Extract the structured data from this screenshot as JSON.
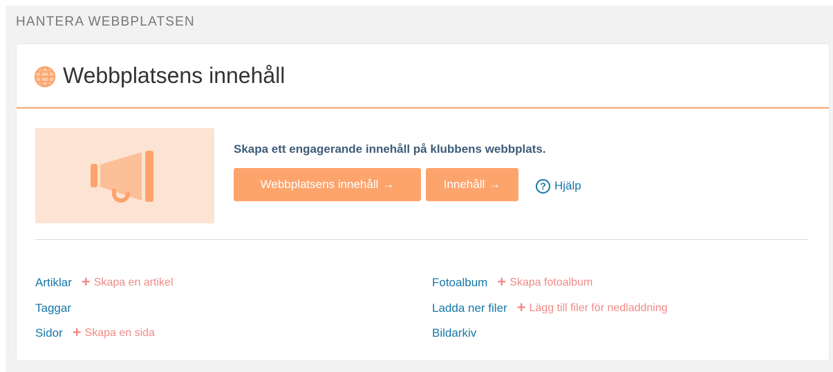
{
  "section_title": "HANTERA WEBBPLATSEN",
  "card": {
    "title": "Webbplatsens innehåll",
    "icon": "globe-icon"
  },
  "promo": {
    "image_icon": "megaphone-icon",
    "text": "Skapa ett engagerande innehåll på klubbens webbplats.",
    "buttons": [
      {
        "label": "Webbplatsens innehåll",
        "arrow": "→"
      },
      {
        "label": "Innehåll",
        "arrow": "→"
      }
    ],
    "help": {
      "icon_glyph": "?",
      "label": "Hjälp"
    }
  },
  "links": {
    "left": [
      {
        "label": "Artiklar",
        "add": "Skapa en artikel"
      },
      {
        "label": "Taggar"
      },
      {
        "label": "Sidor",
        "add": "Skapa en sida"
      }
    ],
    "right": [
      {
        "label": "Fotoalbum",
        "add": "Skapa fotoalbum"
      },
      {
        "label": "Ladda ner filer",
        "add": "Lägg till filer för nedladdning"
      },
      {
        "label": "Bildarkiv"
      }
    ],
    "plus_glyph": "+"
  },
  "colors": {
    "accent": "#fda46c",
    "link": "#1676a7",
    "add_link": "#ef8a86",
    "promo_bg": "#fde3d3",
    "header_rule": "#f5a46a"
  }
}
